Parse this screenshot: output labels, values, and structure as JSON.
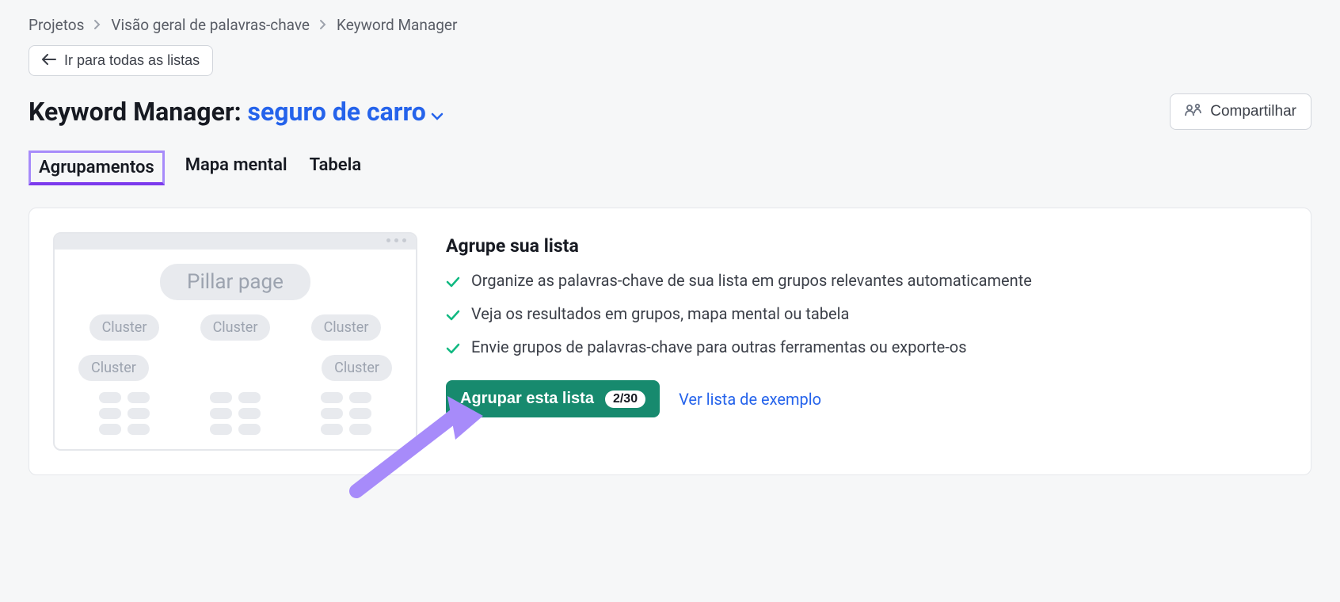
{
  "breadcrumbs": {
    "items": [
      "Projetos",
      "Visão geral de palavras-chave",
      "Keyword Manager"
    ]
  },
  "back_button": "Ir para todas as listas",
  "title": {
    "prefix": "Keyword Manager:",
    "list_name": "seguro de carro"
  },
  "share_button": "Compartilhar",
  "tabs": [
    {
      "label": "Agrupamentos",
      "active": true
    },
    {
      "label": "Mapa mental",
      "active": false
    },
    {
      "label": "Tabela",
      "active": false
    }
  ],
  "illustration": {
    "pillar_label": "Pillar page",
    "cluster_label": "Cluster"
  },
  "cluster_panel": {
    "heading": "Agrupe sua lista",
    "features": [
      "Organize as palavras-chave de sua lista em grupos relevantes automaticamente",
      "Veja os resultados em grupos, mapa mental ou tabela",
      "Envie grupos de palavras-chave para outras ferramentas ou exporte-os"
    ],
    "cta_label": "Agrupar esta lista",
    "cta_badge": "2/30",
    "example_link": "Ver lista de exemplo"
  }
}
